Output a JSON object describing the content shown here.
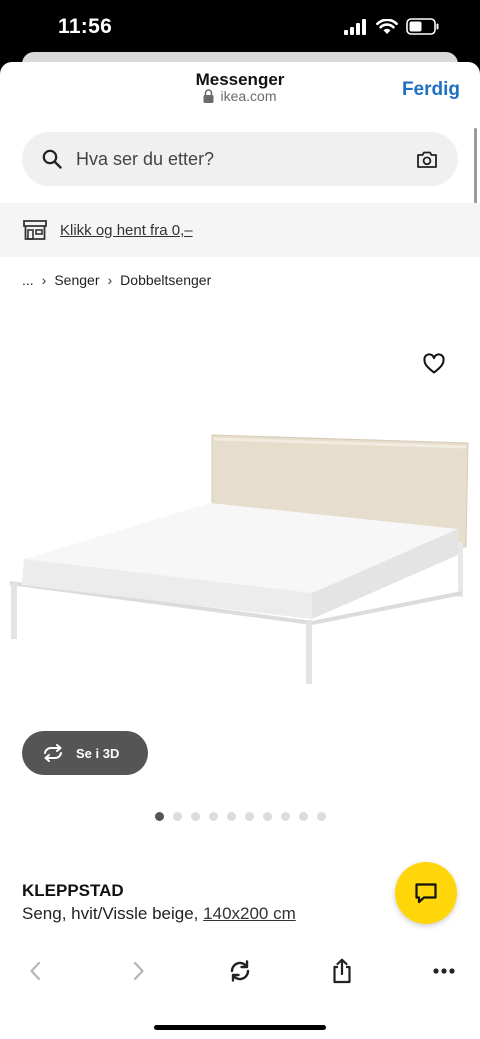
{
  "status_bar": {
    "time": "11:56"
  },
  "browser": {
    "title": "Messenger",
    "url": "ikea.com",
    "done_label": "Ferdig"
  },
  "search": {
    "placeholder": "Hva ser du etter?"
  },
  "pickup": {
    "text": "Klikk og hent fra 0,–"
  },
  "breadcrumb": {
    "items": [
      "...",
      "Senger",
      "Dobbeltsenger"
    ]
  },
  "gallery": {
    "view3d_label": "Se i 3D",
    "total_images": 10,
    "active_index": 0
  },
  "product": {
    "name": "KLEPPSTAD",
    "description": "Seng, hvit/Vissle beige,",
    "size": "140x200 cm"
  },
  "colors": {
    "accent_blue": "#1f6fc4",
    "chat_yellow": "#ffd60a",
    "view3d_bg": "#555555"
  },
  "icons": {
    "lock": "lock-icon",
    "search": "search-icon",
    "camera": "camera-icon",
    "store": "store-icon",
    "heart": "heart-icon",
    "rotate": "rotate-3d-icon",
    "chat": "chat-icon",
    "back": "chevron-left-icon",
    "forward": "chevron-right-icon",
    "reload": "reload-icon",
    "share": "share-icon",
    "more": "more-icon"
  }
}
